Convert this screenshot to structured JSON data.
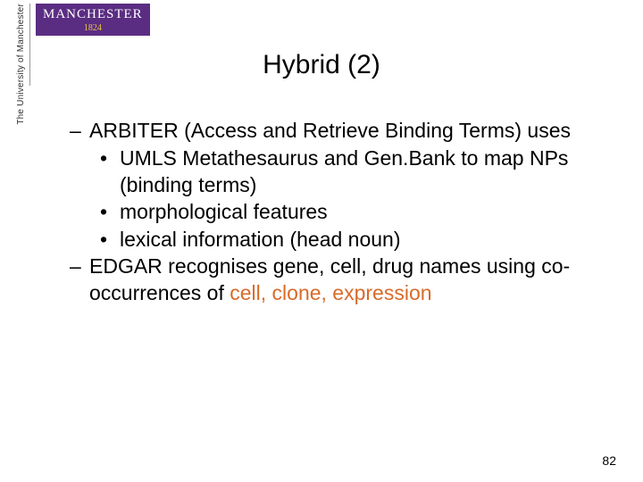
{
  "logo": {
    "vertical_text": "The University\nof Manchester",
    "badge_line1": "MANCHESTER",
    "badge_line2": "1824"
  },
  "title": "Hybrid (2)",
  "bullets": {
    "b1": "ARBITER (Access and Retrieve Binding Terms) uses",
    "b1a": "UMLS Metathesaurus and Gen.Bank to map NPs (binding terms)",
    "b1b": "morphological features",
    "b1c": "lexical information (head noun)",
    "b2_pre": "EDGAR recognises gene, cell, drug names using co-occurrences of ",
    "b2_hl": "cell, clone, expression"
  },
  "page_number": "82"
}
